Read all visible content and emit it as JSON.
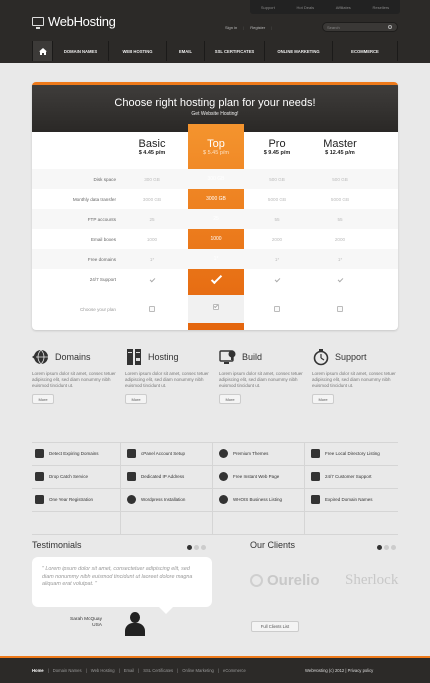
{
  "header": {
    "logo_text": "WebHosting",
    "top_links": [
      "Support",
      "Hot Deals",
      "Affiliates",
      "Resellers"
    ],
    "sign_in": "Sign in",
    "register": "Register",
    "search_label": "Search",
    "nav": [
      "Domain names",
      "Web hosting",
      "Email",
      "SSL certificates",
      "Online marketing",
      "eCommerce"
    ]
  },
  "pricing": {
    "title": "Choose right hosting plan for your needs!",
    "subtitle": "Get Website Hosting!",
    "plans": [
      {
        "name": "Basic",
        "price": "$ 4.45 p/m"
      },
      {
        "name": "Top",
        "price": "$ 5.45 p/m"
      },
      {
        "name": "Pro",
        "price": "$ 9.45 p/m"
      },
      {
        "name": "Master",
        "price": "$ 12.45 p/m"
      }
    ],
    "rows": [
      {
        "label": "Disk space",
        "values": [
          "300 GB",
          "300 GB",
          "500 GB",
          "500 GB"
        ]
      },
      {
        "label": "Monthly data transfer",
        "values": [
          "3000 GB",
          "3000 GB",
          "5000 GB",
          "5000 GB"
        ]
      },
      {
        "label": "FTP accounts",
        "values": [
          "25",
          "25",
          "55",
          "55"
        ]
      },
      {
        "label": "Email boxes",
        "values": [
          "1000",
          "1000",
          "2000",
          "2000"
        ]
      },
      {
        "label": "Free domains",
        "values": [
          "1*",
          "1*",
          "1*",
          "1*"
        ]
      },
      {
        "label": "24/7 Support",
        "values": [
          "check",
          "check",
          "check",
          "check"
        ]
      }
    ],
    "choose_label": "Choose your plan",
    "accent_color": "#ee7a1b"
  },
  "features": [
    {
      "title": "Domains",
      "icon": "globe-icon",
      "text": "Lorem ipsum dolor sit amet, consec tetuer adipiscing elit, sed diam nonummy nibh euismod tincidunt ut.",
      "button": "More"
    },
    {
      "title": "Hosting",
      "icon": "server-icon",
      "text": "Lorem ipsum dolor sit amet, consec tetuer adipiscing elit, sed diam nonummy nibh euismod tincidunt ut.",
      "button": "More"
    },
    {
      "title": "Build",
      "icon": "build-icon",
      "text": "Lorem ipsum dolor sit amet, consec tetuer adipiscing elit, sed diam nonummy nibh euismod tincidunt ut.",
      "button": "More"
    },
    {
      "title": "Support",
      "icon": "stopwatch-icon",
      "text": "Lorem ipsum dolor sit amet, consec tetuer adipiscing elit, sed diam nonummy nibh euismod tincidunt ut.",
      "button": "More"
    }
  ],
  "services": [
    "Detect Expiring Domains",
    "cPanel Account Setup",
    "Premium Themes",
    "Free Local Directory Listing",
    "Drop Catch Service",
    "Dedicated IP Address",
    "Free Instant Web Page",
    "24/7 Customer Support",
    "One Year Registration",
    "Wordpress Installation",
    "WHOIS Business Listing",
    "Expired Domain Names"
  ],
  "testimonials": {
    "title": "Testimonials",
    "quote": "\" Lorem ipsum dolor sit amet, consectetuer adipiscing elit, sed diam nonummy nibh euismod tincidunt ut laoreet dolore magna aliquam erat volutpat. \"",
    "author_name": "Sarah McQuay",
    "author_country": "USA"
  },
  "clients": {
    "title": "Our Clients",
    "logos": [
      "Ourelio",
      "Sherlock"
    ],
    "button": "Full Clients List"
  },
  "footer": {
    "links": [
      "Home",
      "Domain Names",
      "Web Hosting",
      "Email",
      "SSL Certificates",
      "Online Marketing",
      "eCommerce"
    ],
    "copyright": "WebHosting (c) 2012 | Privacy policy"
  }
}
